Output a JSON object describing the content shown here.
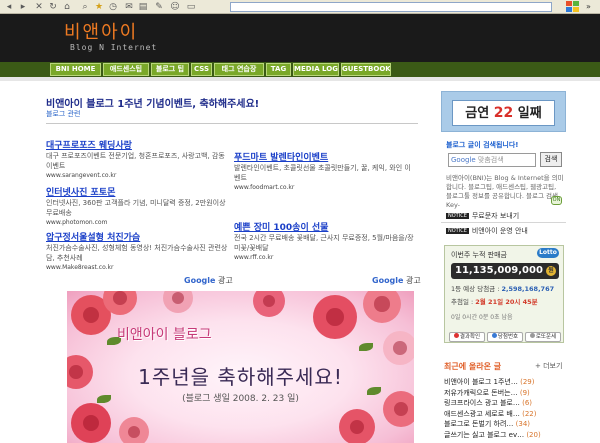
{
  "header": {
    "logo_main": "비앤아이",
    "logo_sub": "Blog N Internet"
  },
  "nav": {
    "items": [
      "BNI HOME",
      "애드센스팁",
      "블로그 팁",
      "CSS",
      "태그 연습장",
      "TAG",
      "MEDIA LOG",
      "GUESTBOOK"
    ]
  },
  "post": {
    "title": "비앤아이 블로그 1주년 기념이벤트, 축하해주세요!",
    "category": "블로그 관련"
  },
  "ads": [
    {
      "title": "대구프로포즈 웨딩사랑",
      "desc": "대구 프로포즈이벤트 전문기업, 청혼프로포즈, 사랑고백, 감동이벤트",
      "url": "www.sarangevent.co.kr"
    },
    {
      "title": "인터넷사진 포토몬",
      "desc": "인터넷사진, 360판 고객플라 기념, 미니달력 증정, 2만원이상 무료배송",
      "url": "www.photomon.com"
    },
    {
      "title": "압구정서울설형 처진가슴",
      "desc": "처진가슴수술사진, 성형체험 동영상! 처진가슴수술사진 관련상담, 추천사례",
      "url": "www.Make8reast.co.kr"
    },
    {
      "title": "푸드마트 발렌타인이벤트",
      "desc": "발렌타인이벤트, 초콜릿선물 초콜릿만들기, 꿀, 케익, 와인 이벤트",
      "url": "www.foodmart.co.kr"
    },
    {
      "title": "예쁜 장미 100송이 선물",
      "desc": "전국 2시간 무료배송 꽃배달, 근사지 무료증정, 5월/마음을/장미꽃/꽃배달",
      "url": "www.rff.co.kr"
    }
  ],
  "google_label": {
    "brand": "Google",
    "suffix": "광고"
  },
  "banner": {
    "line1": "비앤아이 블로그",
    "line2": "1주년을 축하해주세요!",
    "line3": "(블로그 생일 2008. 2. 23 일)"
  },
  "sidebar": {
    "ticker": {
      "prefix": "금연",
      "number": "22",
      "suffix": "일째"
    },
    "search_title": "블로그 글이 검색됩니다!",
    "search_placeholder": "맞춤검색",
    "search_brand": "Google",
    "search_button": "검색",
    "description": "비앤아이(BNI)는 Blog & Internet을 의미합니다. 블로그팁, 애드센스팁, 웹광고팁, 블로그툴 정보를 공유합니다. 블로그 검색 Key-",
    "toggle_label": "ON",
    "rows": [
      {
        "tag": "NOTICE",
        "text": "무료문자 보내기"
      },
      {
        "tag": "NOTICE",
        "text": "비앤아이 운영 안내"
      }
    ]
  },
  "lotto": {
    "header": "이번주 누적 판매금",
    "logo": "Lotto",
    "amount": "11,135,009,000",
    "coin": "원",
    "first_label": "1등 예상 당첨금 :",
    "first_value": "2,598,168,767",
    "draw_label": "추첨일 :",
    "draw_value": "2월 21일 20시 45분",
    "remain": "0일 0시간 0분 0초 남음",
    "buttons": [
      "결과확인",
      "당첨번호",
      "로또운세"
    ]
  },
  "recent": {
    "title": "최근에 올라온 글",
    "more": "+ 더보기",
    "items": [
      {
        "text": "비앤아이 블로그 1주년…",
        "count": "(29)"
      },
      {
        "text": "저유가캐릭으로 돈버는…",
        "count": "(9)"
      },
      {
        "text": "링크프라이스 광고 블로…",
        "count": "(6)"
      },
      {
        "text": "애드센스광고 세로로 배…",
        "count": "(22)"
      },
      {
        "text": "블로그로 돈벌기 하려…",
        "count": "(34)"
      },
      {
        "text": "글쓰기는 싫고 블로그 ev…",
        "count": "(20)"
      }
    ]
  },
  "colors": {
    "accent_orange": "#ee7a22",
    "nav_green": "#7aa829",
    "link_blue": "#1a3fc8",
    "title_navy": "#1e2b8a"
  }
}
